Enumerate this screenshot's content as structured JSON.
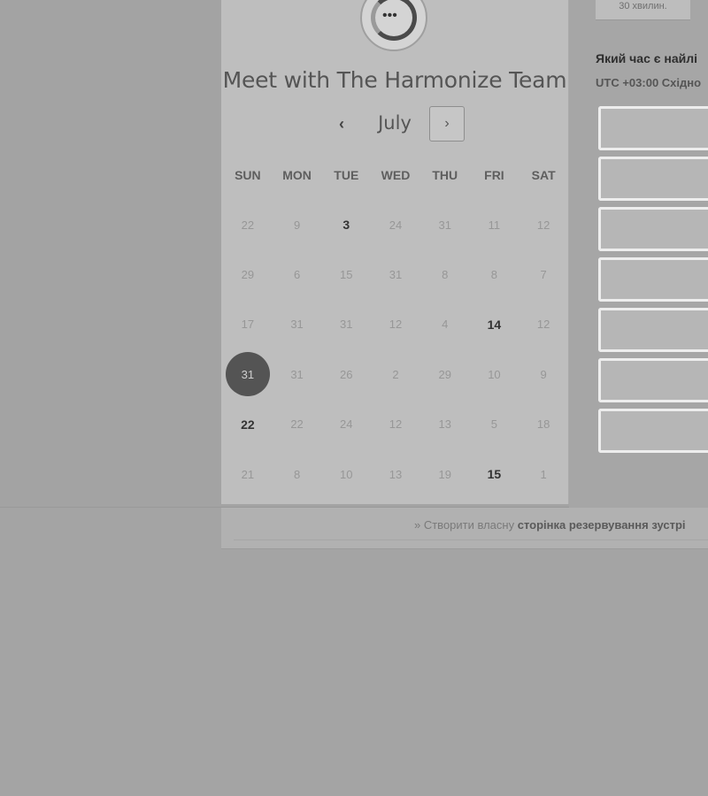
{
  "booking": {
    "title": "Meet with The Harmonize Team",
    "month": "July",
    "prev_icon": "‹",
    "next_icon": "›"
  },
  "calendar": {
    "weekdays": [
      "SUN",
      "MON",
      "TUE",
      "WED",
      "THU",
      "FRI",
      "SAT"
    ],
    "weeks": [
      [
        "22",
        "9",
        "3",
        "24",
        "31",
        "11",
        "12"
      ],
      [
        "29",
        "6",
        "15",
        "31",
        "8",
        "8",
        "7"
      ],
      [
        "17",
        "31",
        "31",
        "12",
        "4",
        "14",
        "12"
      ],
      [
        "31",
        "31",
        "26",
        "2",
        "29",
        "10",
        "9"
      ],
      [
        "22",
        "22",
        "24",
        "12",
        "13",
        "5",
        "18"
      ],
      [
        "21",
        "8",
        "10",
        "13",
        "19",
        "15",
        "1"
      ]
    ],
    "available": [
      [
        0,
        2
      ],
      [
        2,
        5
      ],
      [
        4,
        0
      ],
      [
        5,
        5
      ]
    ],
    "selected": [
      3,
      0
    ]
  },
  "side_panel": {
    "duration": "30 хвилин.",
    "question": "Який час є найлі",
    "timezone": "UTC +03:00 Східно",
    "slots": [
      "",
      "",
      "",
      "",
      "",
      "",
      ""
    ]
  },
  "footer": {
    "prefix": "» Створити власну ",
    "bold": "сторінка резервування зустрі"
  },
  "colors": {
    "selected_day": "#545454",
    "card_bg": "#bebebe",
    "page_bg": "#a4a4a4"
  }
}
